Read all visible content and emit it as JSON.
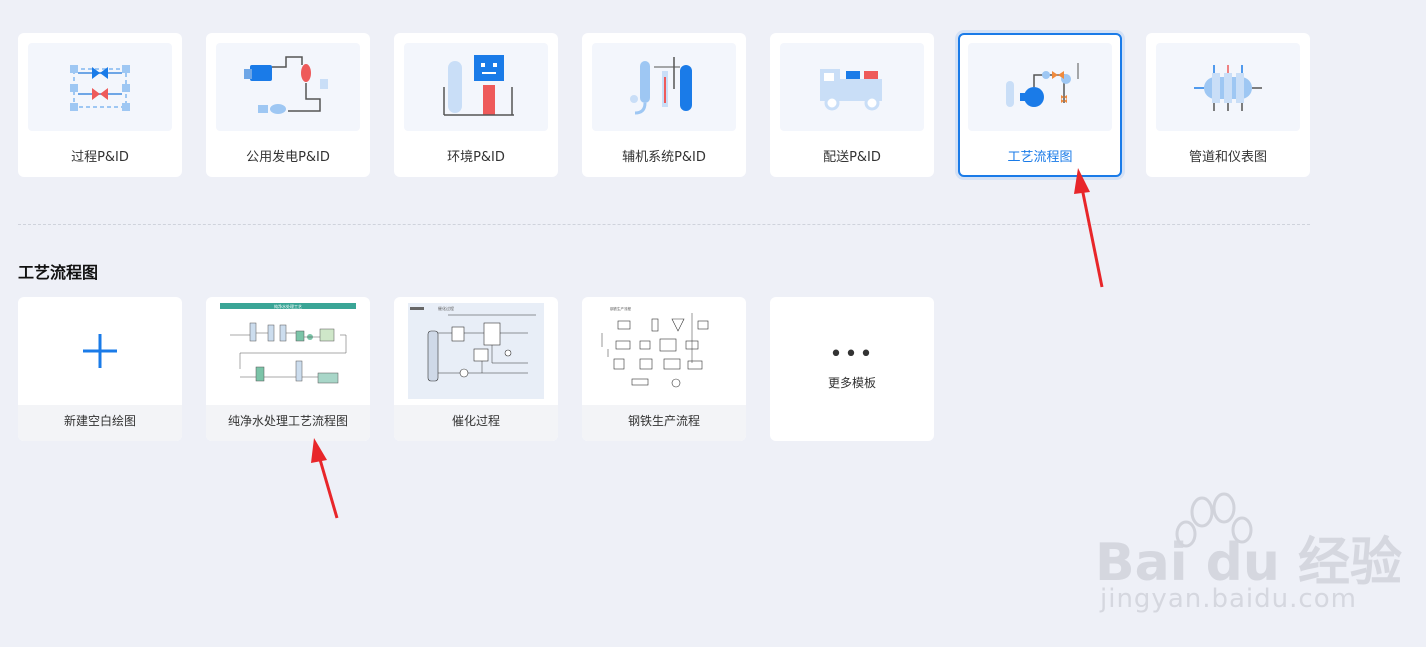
{
  "categories": [
    {
      "label": "过程P&ID",
      "icon": "process-pid-icon",
      "selected": false
    },
    {
      "label": "公用发电P&ID",
      "icon": "power-generation-icon",
      "selected": false
    },
    {
      "label": "环境P&ID",
      "icon": "environment-icon",
      "selected": false
    },
    {
      "label": "辅机系统P&ID",
      "icon": "auxiliary-system-icon",
      "selected": false
    },
    {
      "label": "配送P&ID",
      "icon": "delivery-truck-icon",
      "selected": false
    },
    {
      "label": "工艺流程图",
      "icon": "process-flow-icon",
      "selected": true
    },
    {
      "label": "管道和仪表图",
      "icon": "piping-instrument-icon",
      "selected": false
    }
  ],
  "section": {
    "title": "工艺流程图"
  },
  "templates": [
    {
      "label": "新建空白绘图",
      "icon": "plus-icon"
    },
    {
      "label": "纯净水处理工艺流程图",
      "preview_title": "纯净水处理工艺"
    },
    {
      "label": "催化过程",
      "preview_title": "催化过程"
    },
    {
      "label": "钢铁生产流程",
      "preview_title": "钢铁生产流程"
    }
  ],
  "more": {
    "dots": "•••",
    "label": "更多模板"
  },
  "watermark": {
    "brand": "Bai du 经验",
    "url": "jingyan.baidu.com"
  },
  "colors": {
    "accent": "#1a7be8",
    "arrow": "#e8262a",
    "page_bg": "#eef0f7"
  }
}
